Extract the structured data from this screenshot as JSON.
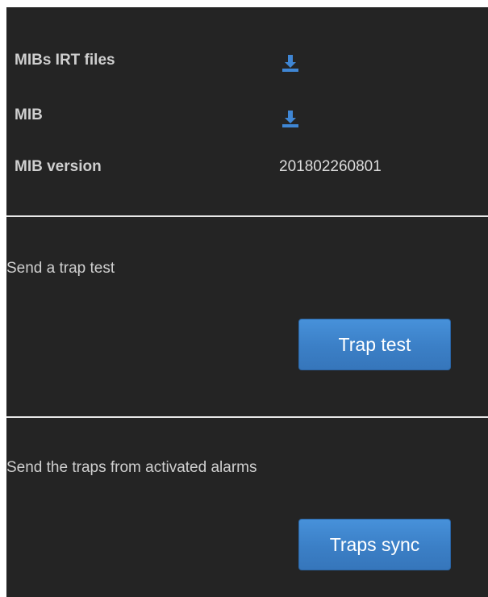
{
  "mib_info": {
    "irt_files_label": "MIBs IRT files",
    "mib_label": "MIB",
    "version_label": "MIB version",
    "version_value": "201802260801",
    "icons": {
      "irt_files": "download-icon",
      "mib": "download-icon"
    }
  },
  "trap_test": {
    "description": "Send a trap test",
    "button_label": "Trap test"
  },
  "traps_sync": {
    "description": "Send the traps from activated alarms",
    "button_label": "Traps sync"
  },
  "colors": {
    "panel_background": "#242424",
    "text": "#cfcfcf",
    "icon_blue": "#3f86d4",
    "button_blue": "#3b7fc6",
    "divider": "#e8e8e8"
  }
}
